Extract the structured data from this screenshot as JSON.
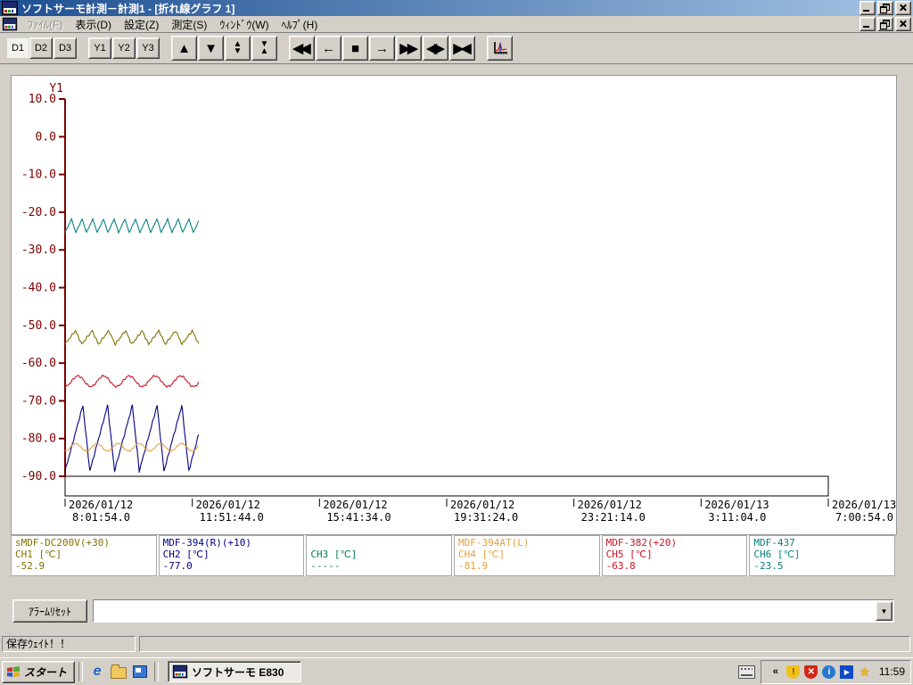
{
  "window": {
    "title": "ソフトサーモ計測－計測1 - [折れ線グラフ 1]"
  },
  "menu": {
    "items": [
      {
        "name": "menu-file",
        "label": "ﾌｧｲﾙ(F)",
        "disabled": true
      },
      {
        "name": "menu-view",
        "label": "表示(D)",
        "disabled": false
      },
      {
        "name": "menu-settings",
        "label": "設定(Z)",
        "disabled": false
      },
      {
        "name": "menu-measure",
        "label": "測定(S)",
        "disabled": false
      },
      {
        "name": "menu-window",
        "label": "ｳｨﾝﾄﾞｳ(W)",
        "disabled": false
      },
      {
        "name": "menu-help",
        "label": "ﾍﾙﾌﾟ(H)",
        "disabled": false
      }
    ]
  },
  "toolbar": {
    "buttons": [
      {
        "name": "d1-button",
        "label": "D1",
        "active": true
      },
      {
        "name": "d2-button",
        "label": "D2"
      },
      {
        "name": "d3-button",
        "label": "D3"
      },
      {
        "gap": true
      },
      {
        "name": "y1-button",
        "label": "Y1"
      },
      {
        "name": "y2-button",
        "label": "Y2"
      },
      {
        "name": "y3-button",
        "label": "Y3"
      },
      {
        "gap": true
      },
      {
        "name": "scroll-up-button",
        "glyph": "▲",
        "big": true
      },
      {
        "name": "scroll-down-button",
        "glyph": "▼",
        "big": true
      },
      {
        "name": "expand-y-button",
        "glyph": "▲|▼",
        "big": true,
        "stacked": true
      },
      {
        "name": "compress-y-button",
        "glyph": "▼|▲",
        "big": true,
        "stacked": true
      },
      {
        "gap": true
      },
      {
        "name": "fast-rewind-button",
        "glyph": "◀◀",
        "big": true,
        "dbl": true
      },
      {
        "name": "step-left-button",
        "glyph": "←",
        "big": true
      },
      {
        "name": "stop-button",
        "glyph": "■",
        "big": true
      },
      {
        "name": "step-right-button",
        "glyph": "→",
        "big": true
      },
      {
        "name": "fast-forward-button",
        "glyph": "▶▶",
        "big": true,
        "dbl": true
      },
      {
        "name": "expand-x-button",
        "glyph": "◀▶",
        "big": true,
        "dbl": true
      },
      {
        "name": "compress-x-button",
        "glyph": "▶◀",
        "big": true,
        "dbl": true
      },
      {
        "gap": true
      },
      {
        "name": "graph-settings-button",
        "icon": "graph",
        "big": true
      }
    ]
  },
  "chart_data": {
    "type": "line",
    "title": "折れ線グラフ 1",
    "y_axis_label": "Y1",
    "ylim": [
      -90,
      10
    ],
    "y_ticks": [
      "10.0",
      "0.0",
      "-10.0",
      "-20.0",
      "-30.0",
      "-40.0",
      "-50.0",
      "-60.0",
      "-70.0",
      "-80.0",
      "-90.0"
    ],
    "x_ticks": [
      {
        "date": "2026/01/12",
        "time": "8:01:54.0"
      },
      {
        "date": "2026/01/12",
        "time": "11:51:44.0"
      },
      {
        "date": "2026/01/12",
        "time": "15:41:34.0"
      },
      {
        "date": "2026/01/12",
        "time": "19:31:24.0"
      },
      {
        "date": "2026/01/12",
        "time": "23:21:14.0"
      },
      {
        "date": "2026/01/13",
        "time": "3:11:04.0"
      },
      {
        "date": "2026/01/13",
        "time": "7:00:54.0"
      }
    ],
    "axis_color": "#7b0000",
    "grid": false,
    "data_fraction": 0.175,
    "series": [
      {
        "channel": "CH6",
        "name": "MDF-437",
        "color": "#0a8080",
        "shape": "sawtooth",
        "rise": 0.6,
        "min": -25.4,
        "max": -21.8,
        "cycles": 12.5,
        "noise": 0.12,
        "current": -23.5
      },
      {
        "channel": "CH1",
        "name": "sMDF-DC200V(+30)",
        "color": "#827200",
        "shape": "sawtooth",
        "rise": 0.62,
        "min": -55.0,
        "max": -51.4,
        "cycles": 8,
        "noise": 0.3,
        "current": -52.9
      },
      {
        "channel": "CH5",
        "name": "MDF-382(+20)",
        "color": "#c81422",
        "shape": "sine",
        "min": -66.2,
        "max": -63.4,
        "cycles": 5.2,
        "noise": 0.25,
        "current": -63.8
      },
      {
        "channel": "CH2",
        "name": "MDF-394(R)(+10)",
        "color": "#000080",
        "shape": "sawtooth",
        "rise": 0.72,
        "min": -88.6,
        "max": -71.2,
        "cycles": 5.4,
        "noise": 0.3,
        "current": -77.0
      },
      {
        "channel": "CH4",
        "name": "MDF-394AT(L)",
        "color": "#e8a040",
        "shape": "sine",
        "min": -83.3,
        "max": -81.3,
        "cycles": 6.3,
        "noise": 0.15,
        "current": -81.9
      }
    ]
  },
  "channels": [
    {
      "name": "sMDF-DC200V(+30)",
      "channel": "CH1 [℃]",
      "value": "-52.9",
      "color": "#827200"
    },
    {
      "name": "MDF-394(R)(+10)",
      "channel": "CH2 [℃]",
      "value": "-77.0",
      "color": "#000080"
    },
    {
      "name": "",
      "channel": "CH3 [℃]",
      "value": "-----",
      "color": "#007f55"
    },
    {
      "name": "MDF-394AT(L)",
      "channel": "CH4 [℃]",
      "value": "-81.9",
      "color": "#e8a040"
    },
    {
      "name": "MDF-382(+20)",
      "channel": "CH5 [℃]",
      "value": "-63.8",
      "color": "#c81422"
    },
    {
      "name": "MDF-437",
      "channel": "CH6 [℃]",
      "value": "-23.5",
      "color": "#0a8080"
    }
  ],
  "alarm": {
    "reset_label": "ｱﾗｰﾑﾘｾｯﾄ",
    "combo_value": ""
  },
  "status_bar": {
    "message": "保存ｳｪｲﾄ！！",
    "message2": ""
  },
  "taskbar": {
    "start_label": "スタート",
    "task_label": "ソフトサーモ  E830",
    "clock": "11:59"
  }
}
